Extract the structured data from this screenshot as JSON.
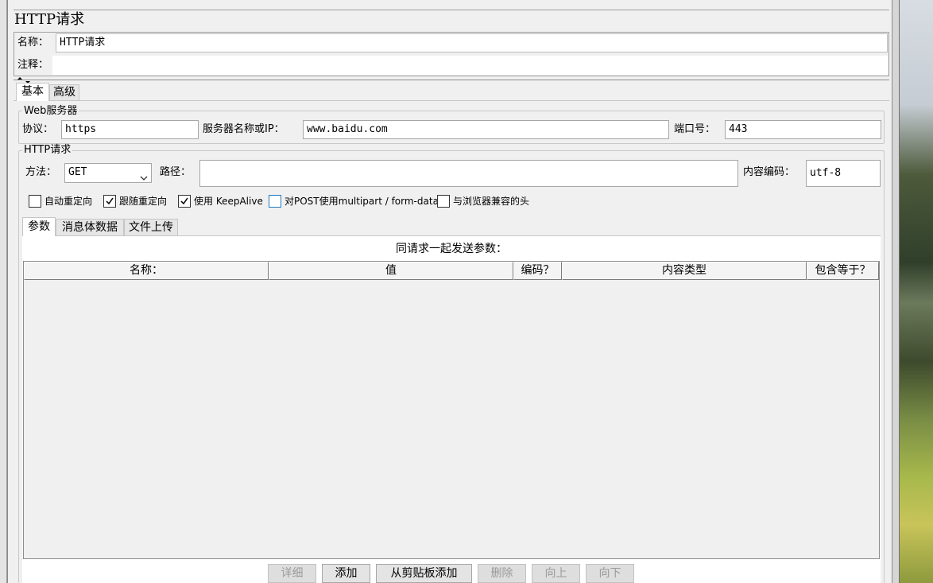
{
  "panel": {
    "title": "HTTP请求"
  },
  "name_row": {
    "label": "名称：",
    "value": "HTTP请求"
  },
  "comment_row": {
    "label": "注释：",
    "value": ""
  },
  "tabs": [
    {
      "label": "基本"
    },
    {
      "label": "高级"
    }
  ],
  "web_server": {
    "legend": "Web服务器",
    "protocol_label": "协议：",
    "protocol_value": "https",
    "server_label": "服务器名称或IP：",
    "server_value": "www.baidu.com",
    "port_label": "端口号：",
    "port_value": "443"
  },
  "http_request": {
    "legend": "HTTP请求",
    "method_label": "方法：",
    "method_value": "GET",
    "path_label": "路径：",
    "path_value": "",
    "encoding_label": "内容编码：",
    "encoding_value": "utf-8"
  },
  "options": [
    {
      "label": "自动重定向",
      "checked": false
    },
    {
      "label": "跟随重定向",
      "checked": true
    },
    {
      "label": "使用 KeepAlive",
      "checked": true
    },
    {
      "label": "对POST使用multipart / form-data",
      "checked": false
    },
    {
      "label": "与浏览器兼容的头",
      "checked": false
    }
  ],
  "subtabs": [
    {
      "label": "参数"
    },
    {
      "label": "消息体数据"
    },
    {
      "label": "文件上传"
    }
  ],
  "params": {
    "caption": "同请求一起发送参数：",
    "columns": [
      "名称：",
      "值",
      "编码？",
      "内容类型",
      "包含等于？"
    ],
    "rows": []
  },
  "buttons": [
    {
      "label": "详细",
      "enabled": false
    },
    {
      "label": "添加",
      "enabled": true
    },
    {
      "label": "从剪贴板添加",
      "enabled": true
    },
    {
      "label": "删除",
      "enabled": false
    },
    {
      "label": "向上",
      "enabled": false
    },
    {
      "label": "向下",
      "enabled": false
    }
  ],
  "icons": {
    "split_handle": "split-arrows-icon",
    "dropdown": "chevron-down-icon",
    "check": "checkmark-icon"
  }
}
